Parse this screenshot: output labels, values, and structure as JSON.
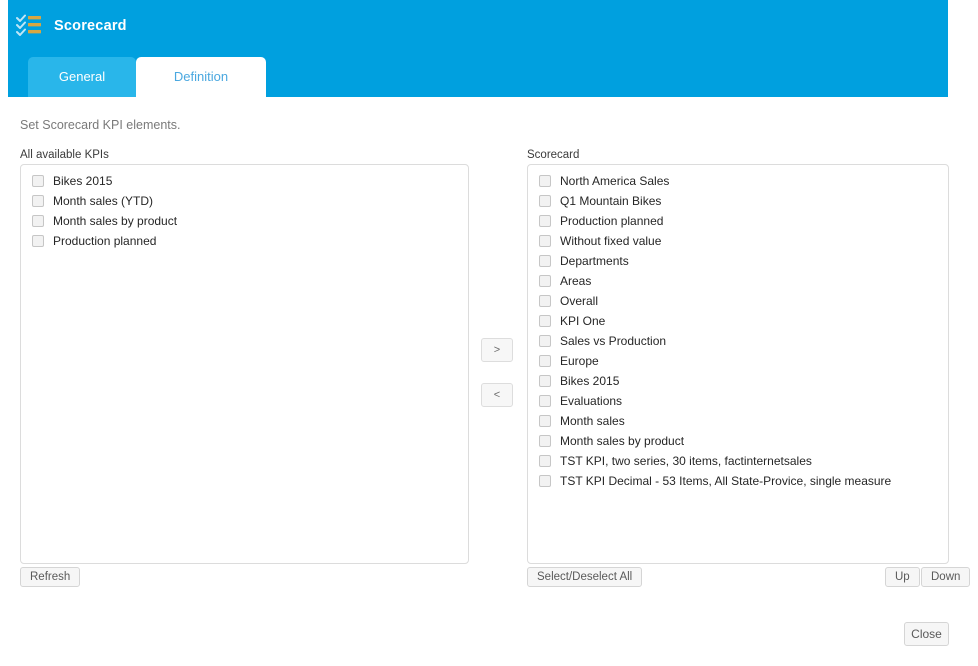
{
  "window": {
    "title": "Scorecard",
    "icon": "scorecard-checklist-icon",
    "header_color": "#00a0df",
    "tab_inactive_color": "#29b6ea",
    "tab_active_text_color": "#4aa8e0",
    "icon_bar_color": "#d9a742"
  },
  "tabs": [
    {
      "label": "General",
      "active": false
    },
    {
      "label": "Definition",
      "active": true
    }
  ],
  "main": {
    "hint": "Set Scorecard KPI elements.",
    "available": {
      "label": "All available KPIs",
      "items": [
        {
          "label": "Bikes 2015",
          "checked": false
        },
        {
          "label": "Month sales (YTD)",
          "checked": false
        },
        {
          "label": "Month sales by product",
          "checked": false
        },
        {
          "label": "Production planned",
          "checked": false
        }
      ],
      "refresh_label": "Refresh"
    },
    "selected": {
      "label": "Scorecard",
      "items": [
        {
          "label": "North America Sales",
          "checked": false
        },
        {
          "label": "Q1 Mountain Bikes",
          "checked": false
        },
        {
          "label": "Production planned",
          "checked": false
        },
        {
          "label": "Without fixed value",
          "checked": false
        },
        {
          "label": "Departments",
          "checked": false
        },
        {
          "label": "Areas",
          "checked": false
        },
        {
          "label": "Overall",
          "checked": false
        },
        {
          "label": "KPI One",
          "checked": false
        },
        {
          "label": "Sales vs Production",
          "checked": false
        },
        {
          "label": "Europe",
          "checked": false
        },
        {
          "label": "Bikes 2015",
          "checked": false
        },
        {
          "label": "Evaluations",
          "checked": false
        },
        {
          "label": "Month sales",
          "checked": false
        },
        {
          "label": "Month sales by product",
          "checked": false
        },
        {
          "label": "TST KPI, two series, 30 items, factinternetsales",
          "checked": false
        },
        {
          "label": "TST KPI Decimal - 53 Items, All State-Provice, single measure",
          "checked": false
        }
      ],
      "select_all_label": "Select/Deselect All",
      "up_label": "Up",
      "down_label": "Down"
    },
    "transfer": {
      "add_label": ">",
      "remove_label": "<"
    }
  },
  "footer": {
    "close_label": "Close"
  }
}
